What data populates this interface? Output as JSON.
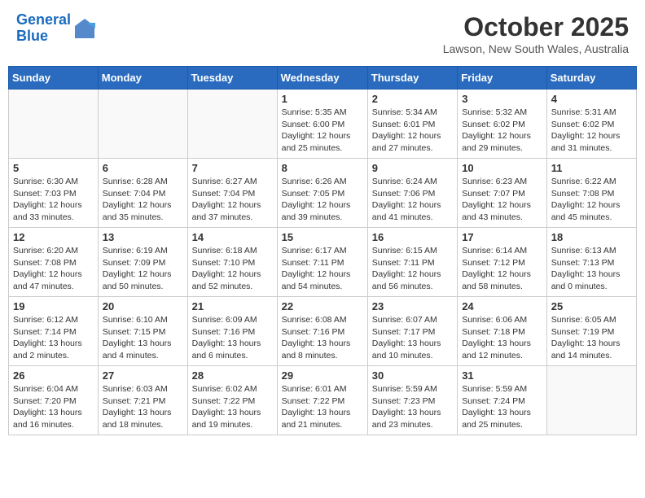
{
  "header": {
    "logo_line1": "General",
    "logo_line2": "Blue",
    "month": "October 2025",
    "location": "Lawson, New South Wales, Australia"
  },
  "weekdays": [
    "Sunday",
    "Monday",
    "Tuesday",
    "Wednesday",
    "Thursday",
    "Friday",
    "Saturday"
  ],
  "weeks": [
    [
      {
        "day": "",
        "info": ""
      },
      {
        "day": "",
        "info": ""
      },
      {
        "day": "",
        "info": ""
      },
      {
        "day": "1",
        "info": "Sunrise: 5:35 AM\nSunset: 6:00 PM\nDaylight: 12 hours\nand 25 minutes."
      },
      {
        "day": "2",
        "info": "Sunrise: 5:34 AM\nSunset: 6:01 PM\nDaylight: 12 hours\nand 27 minutes."
      },
      {
        "day": "3",
        "info": "Sunrise: 5:32 AM\nSunset: 6:02 PM\nDaylight: 12 hours\nand 29 minutes."
      },
      {
        "day": "4",
        "info": "Sunrise: 5:31 AM\nSunset: 6:02 PM\nDaylight: 12 hours\nand 31 minutes."
      }
    ],
    [
      {
        "day": "5",
        "info": "Sunrise: 6:30 AM\nSunset: 7:03 PM\nDaylight: 12 hours\nand 33 minutes."
      },
      {
        "day": "6",
        "info": "Sunrise: 6:28 AM\nSunset: 7:04 PM\nDaylight: 12 hours\nand 35 minutes."
      },
      {
        "day": "7",
        "info": "Sunrise: 6:27 AM\nSunset: 7:04 PM\nDaylight: 12 hours\nand 37 minutes."
      },
      {
        "day": "8",
        "info": "Sunrise: 6:26 AM\nSunset: 7:05 PM\nDaylight: 12 hours\nand 39 minutes."
      },
      {
        "day": "9",
        "info": "Sunrise: 6:24 AM\nSunset: 7:06 PM\nDaylight: 12 hours\nand 41 minutes."
      },
      {
        "day": "10",
        "info": "Sunrise: 6:23 AM\nSunset: 7:07 PM\nDaylight: 12 hours\nand 43 minutes."
      },
      {
        "day": "11",
        "info": "Sunrise: 6:22 AM\nSunset: 7:08 PM\nDaylight: 12 hours\nand 45 minutes."
      }
    ],
    [
      {
        "day": "12",
        "info": "Sunrise: 6:20 AM\nSunset: 7:08 PM\nDaylight: 12 hours\nand 47 minutes."
      },
      {
        "day": "13",
        "info": "Sunrise: 6:19 AM\nSunset: 7:09 PM\nDaylight: 12 hours\nand 50 minutes."
      },
      {
        "day": "14",
        "info": "Sunrise: 6:18 AM\nSunset: 7:10 PM\nDaylight: 12 hours\nand 52 minutes."
      },
      {
        "day": "15",
        "info": "Sunrise: 6:17 AM\nSunset: 7:11 PM\nDaylight: 12 hours\nand 54 minutes."
      },
      {
        "day": "16",
        "info": "Sunrise: 6:15 AM\nSunset: 7:11 PM\nDaylight: 12 hours\nand 56 minutes."
      },
      {
        "day": "17",
        "info": "Sunrise: 6:14 AM\nSunset: 7:12 PM\nDaylight: 12 hours\nand 58 minutes."
      },
      {
        "day": "18",
        "info": "Sunrise: 6:13 AM\nSunset: 7:13 PM\nDaylight: 13 hours\nand 0 minutes."
      }
    ],
    [
      {
        "day": "19",
        "info": "Sunrise: 6:12 AM\nSunset: 7:14 PM\nDaylight: 13 hours\nand 2 minutes."
      },
      {
        "day": "20",
        "info": "Sunrise: 6:10 AM\nSunset: 7:15 PM\nDaylight: 13 hours\nand 4 minutes."
      },
      {
        "day": "21",
        "info": "Sunrise: 6:09 AM\nSunset: 7:16 PM\nDaylight: 13 hours\nand 6 minutes."
      },
      {
        "day": "22",
        "info": "Sunrise: 6:08 AM\nSunset: 7:16 PM\nDaylight: 13 hours\nand 8 minutes."
      },
      {
        "day": "23",
        "info": "Sunrise: 6:07 AM\nSunset: 7:17 PM\nDaylight: 13 hours\nand 10 minutes."
      },
      {
        "day": "24",
        "info": "Sunrise: 6:06 AM\nSunset: 7:18 PM\nDaylight: 13 hours\nand 12 minutes."
      },
      {
        "day": "25",
        "info": "Sunrise: 6:05 AM\nSunset: 7:19 PM\nDaylight: 13 hours\nand 14 minutes."
      }
    ],
    [
      {
        "day": "26",
        "info": "Sunrise: 6:04 AM\nSunset: 7:20 PM\nDaylight: 13 hours\nand 16 minutes."
      },
      {
        "day": "27",
        "info": "Sunrise: 6:03 AM\nSunset: 7:21 PM\nDaylight: 13 hours\nand 18 minutes."
      },
      {
        "day": "28",
        "info": "Sunrise: 6:02 AM\nSunset: 7:22 PM\nDaylight: 13 hours\nand 19 minutes."
      },
      {
        "day": "29",
        "info": "Sunrise: 6:01 AM\nSunset: 7:22 PM\nDaylight: 13 hours\nand 21 minutes."
      },
      {
        "day": "30",
        "info": "Sunrise: 5:59 AM\nSunset: 7:23 PM\nDaylight: 13 hours\nand 23 minutes."
      },
      {
        "day": "31",
        "info": "Sunrise: 5:59 AM\nSunset: 7:24 PM\nDaylight: 13 hours\nand 25 minutes."
      },
      {
        "day": "",
        "info": ""
      }
    ]
  ]
}
